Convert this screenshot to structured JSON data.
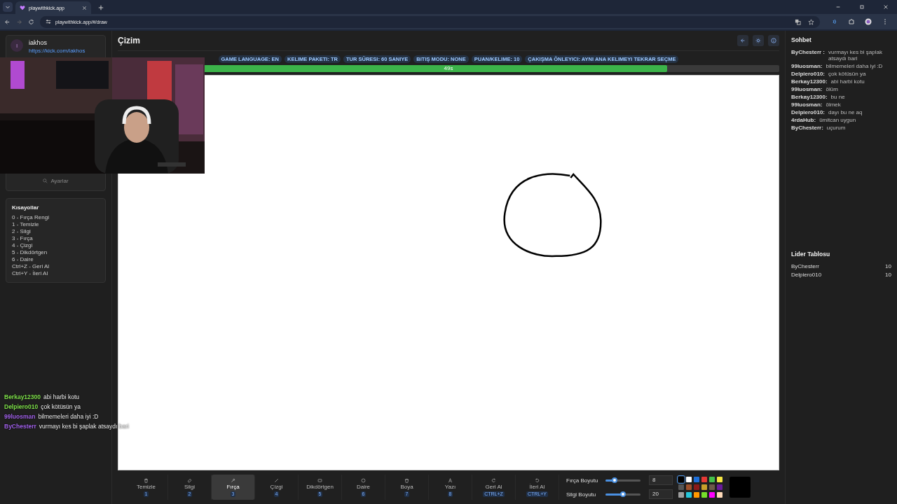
{
  "browser": {
    "tab_title": "playwithkick.app",
    "address": "playwithkick.app/#/draw"
  },
  "sidebar": {
    "user": {
      "initial": "I",
      "name": "iakhos",
      "link": "https://kick.com/iakhos"
    },
    "settings_button": "Ayarlar",
    "shortcuts_title": "Kısayollar",
    "shortcuts": [
      "0 - Fırça Rengi",
      "1 - Temizle",
      "2 - Silgi",
      "3 - Fırça",
      "4 - Çizgi",
      "5 - Dikdörtgen",
      "6 - Daire",
      "Ctrl+Z - Geri Al",
      "Ctrl+Y - İleri Al"
    ]
  },
  "stream_chat": [
    {
      "user": "Berkay12300",
      "message": "abi harbi kotu",
      "color": "#7ee04a"
    },
    {
      "user": "Delpiero010",
      "message": "çok kötüsün ya",
      "color": "#7ee04a"
    },
    {
      "user": "99luosman",
      "message": "bilmemeleri daha iyi :D",
      "color": "#a061e8"
    },
    {
      "user": "ByChesterr",
      "message": "vurmayı kes bi şaplak atsaydı bari",
      "color": "#a061e8"
    }
  ],
  "main": {
    "title": "Çizim",
    "chips": [
      "GAME LANGUAGE: EN",
      "KELIME PAKETI: TR",
      "TUR SÜRESI: 60 SANIYE",
      "BITIŞ MODU: NONE",
      "PUAN/KELIME: 10",
      "ÇAKIŞMA ÖNLEYICI: AYNI ANA KELIMEYI TEKRAR SEÇME"
    ],
    "timer": {
      "label": "49s",
      "level": 0.83
    }
  },
  "tools": [
    {
      "label": "Temizle",
      "key": "1",
      "selected": false
    },
    {
      "label": "Silgi",
      "key": "2",
      "selected": false
    },
    {
      "label": "Fırça",
      "key": "3",
      "selected": true
    },
    {
      "label": "Çizgi",
      "key": "4",
      "selected": false
    },
    {
      "label": "Dikdörtgen",
      "key": "5",
      "selected": false
    },
    {
      "label": "Daire",
      "key": "6",
      "selected": false
    },
    {
      "label": "Boya",
      "key": "7",
      "selected": false
    },
    {
      "label": "Yazı",
      "key": "8",
      "selected": false
    },
    {
      "label": "Geri Al",
      "key": "CTRL+Z",
      "selected": false
    },
    {
      "label": "İleri Al",
      "key": "CTRL+Y",
      "selected": false
    }
  ],
  "sliders": [
    {
      "label": "Fırça Boyutu",
      "level": 0.25,
      "value": "8"
    },
    {
      "label": "Silgi Boyutu",
      "level": 0.5,
      "value": "20"
    }
  ],
  "palette": [
    {
      "color": "#000000",
      "selected": true
    },
    {
      "color": "#ffffff"
    },
    {
      "color": "#1e6fd9"
    },
    {
      "color": "#e53935"
    },
    {
      "color": "#43c04a"
    },
    {
      "color": "#f5e642"
    },
    {
      "color": "#555555"
    },
    {
      "color": "#a0522d"
    },
    {
      "color": "#8b1a1a"
    },
    {
      "color": "#c8a02a"
    },
    {
      "color": "#6d5a4a"
    },
    {
      "color": "#6a1b9a"
    },
    {
      "color": "#9e9e9e"
    },
    {
      "color": "#26c6da"
    },
    {
      "color": "#ff9800"
    },
    {
      "color": "#76e02a"
    },
    {
      "color": "#ff00ff"
    },
    {
      "color": "#ffdab9"
    }
  ],
  "chat": {
    "title": "Sohbet",
    "messages": [
      {
        "user": "ByChesterr :",
        "text": "vurmayı kes bi şaplak atsaydı bari"
      },
      {
        "user": "99luosman:",
        "text": "bilmemeleri daha iyi :D"
      },
      {
        "user": "Delpiero010:",
        "text": "çok kötüsün ya"
      },
      {
        "user": "Berkay12300:",
        "text": "abi harbi kotu"
      },
      {
        "user": "99luosman:",
        "text": "ölüm"
      },
      {
        "user": "Berkay12300:",
        "text": "bu ne"
      },
      {
        "user": "99luosman:",
        "text": "ölmek"
      },
      {
        "user": "Delpiero010:",
        "text": "dayı bu ne aq"
      },
      {
        "user": "4rdaHub:",
        "text": "ümitcan uygun"
      },
      {
        "user": "ByChesterr:",
        "text": "uçurum"
      }
    ]
  },
  "leaderboard": {
    "title": "Lider Tablosu",
    "rows": [
      {
        "name": "ByChesterr",
        "score": "10"
      },
      {
        "name": "Delpiero010",
        "score": "10"
      }
    ]
  }
}
